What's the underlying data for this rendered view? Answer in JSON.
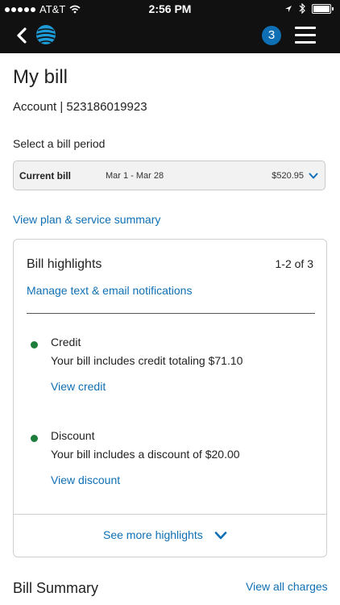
{
  "status_bar": {
    "carrier": "AT&T",
    "time": "2:56 PM"
  },
  "nav": {
    "notification_count": "3"
  },
  "page": {
    "title": "My bill",
    "account": "Account | 523186019923",
    "select_label": "Select a bill period"
  },
  "bill_select": {
    "label": "Current bill",
    "dates": "Mar 1 - Mar 28",
    "amount": "$520.95"
  },
  "plan_link": "View plan & service summary",
  "highlights": {
    "title": "Bill highlights",
    "count": "1-2 of 3",
    "notifications_link": "Manage text & email notifications",
    "items": [
      {
        "title": "Credit",
        "text": "Your bill includes credit totaling $71.10",
        "link": "View credit"
      },
      {
        "title": "Discount",
        "text": "Your bill includes a discount of $20.00",
        "link": "View discount"
      }
    ],
    "more_label": "See more highlights"
  },
  "summary": {
    "title": "Bill Summary",
    "view_all": "View all charges"
  },
  "colors": {
    "brand_blue": "#0f6fb4",
    "status_green": "#1d7d3a",
    "header_bg": "#111111"
  }
}
